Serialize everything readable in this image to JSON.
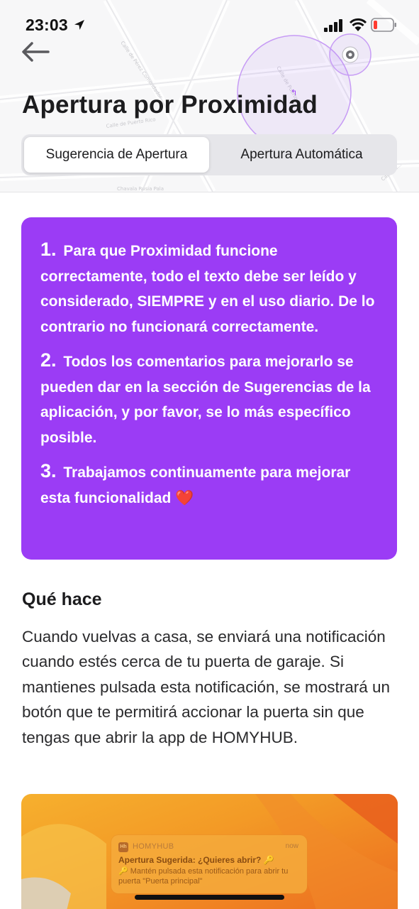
{
  "status_bar": {
    "time": "23:03"
  },
  "header": {
    "title": "Apertura por Proximidad",
    "tabs": [
      {
        "label": "Sugerencia de Apertura",
        "active": true
      },
      {
        "label": "Apertura Automática",
        "active": false
      }
    ],
    "map_street_labels": [
      "Calle de Puerto Rico",
      "Calle de Pérez Comendador",
      "Calle de Puerto Real",
      "Chavala Rusia Pala",
      "Calle de..."
    ]
  },
  "info_card": {
    "color": "#9b3cf5",
    "items": [
      {
        "number": "1.",
        "text": "Para que Proximidad funcione correctamente, todo el texto debe ser leído y considerado, SIEMPRE y en el uso diario. De lo contrario no funcionará correctamente."
      },
      {
        "number": "2.",
        "text": "Todos los comentarios para mejorarlo se pueden dar en la sección de Sugerencias de la aplicación, y por favor, se lo más específico posible."
      },
      {
        "number": "3.",
        "text": "Trabajamos continuamente para mejorar esta funcionalidad ❤️"
      }
    ]
  },
  "section": {
    "title": "Qué hace",
    "body": "Cuando vuelvas a casa, se enviará una notificación cuando estés cerca de tu puerta de garaje. Si mantienes pulsada esta notificación, se mostrará un botón que te permitirá accionar la puerta sin que tengas que abrir la app de HOMYHUB."
  },
  "preview": {
    "notification": {
      "app_icon_text": "Hh",
      "app_name": "HOMYHUB",
      "time": "now",
      "title": "Apertura Sugerida: ¿Quieres abrir? 🔑",
      "body": "🔑 Mantén pulsada esta notificación para abrir tu puerta \"Puerta principal\""
    }
  }
}
